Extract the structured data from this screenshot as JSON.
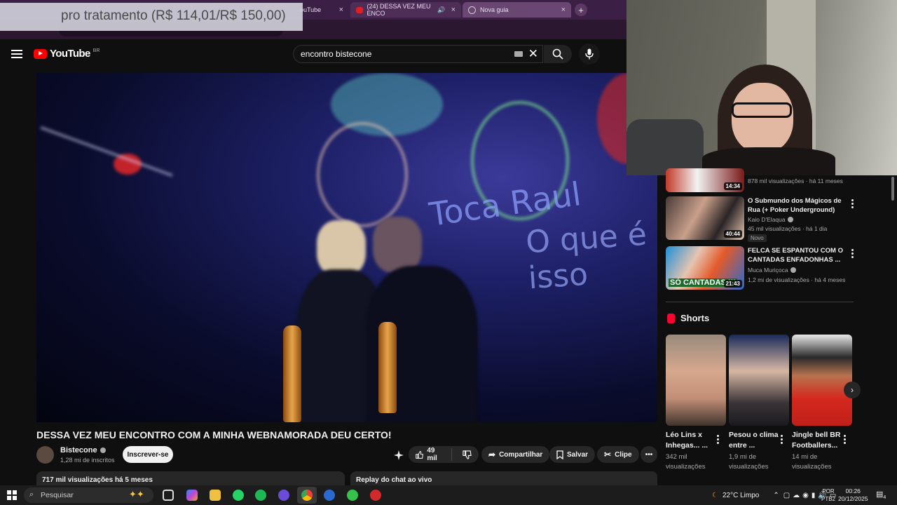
{
  "overlay": {
    "text": "pro tratamento (R$ 114,01/R$ 150,00)"
  },
  "browser": {
    "tabs": [
      {
        "label": "ouTube"
      },
      {
        "label": "(24) DESSA VEZ MEU ENCO"
      },
      {
        "label": "Nova guia"
      }
    ],
    "new_tab": "+",
    "close_glyph": "×"
  },
  "youtube": {
    "logo_text": "YouTube",
    "region": "BR",
    "search_query": "encontro bistecone",
    "video": {
      "title": "DESSA VEZ MEU ENCONTRO COM A MINHA WEBNAMORADA DEU CERTO!",
      "channel": "Bistecone",
      "subscribers": "1,28 mi de inscritos",
      "subscribe_label": "Inscrever-se",
      "likes": "49 mil",
      "share_label": "Compartilhar",
      "save_label": "Salvar",
      "clip_label": "Clipe",
      "views_date": "717 mil visualizações  há 5 meses",
      "chat_replay": "Replay do chat ao vivo",
      "graffiti_1": "Toca Raul",
      "graffiti_2": "O que é isso"
    },
    "recommendations": [
      {
        "duration": "14:34",
        "meta": "878 mil visualizações · há 11 meses"
      },
      {
        "title": "O Submundo dos Mágicos de Rua (+ Poker Underground)",
        "channel": "Kaio D'Elaqua",
        "meta": "45 mil visualizações · há 1 dia",
        "badge": "Novo",
        "duration": "40:44"
      },
      {
        "title": "FELCA SE ESPANTOU COM O CANTADAS ENFADONHAS ...",
        "channel": "Muca Muriçoca",
        "meta": "1,2 mi de visualizações · há 4 meses",
        "duration": "21:43",
        "thumb_text": "SÓ CANTADAS !!!"
      }
    ],
    "shorts": {
      "heading": "Shorts",
      "items": [
        {
          "title": "Léo Lins x Inhegas... ...",
          "views": "342 mil visualizações"
        },
        {
          "title": "Pesou o clima entre ...",
          "views": "1,9 mi de visualizações"
        },
        {
          "title": "Jingle bell BR Footballers...",
          "views": "14 mi de visualizações"
        }
      ]
    }
  },
  "taskbar": {
    "search_placeholder": "Pesquisar",
    "weather": "22°C  Limpo",
    "lang_1": "POR",
    "lang_2": "PTB2",
    "time": "00:26",
    "date": "20/12/2025",
    "notifications": "4"
  },
  "colors": {
    "accent": "#ff0000",
    "bg": "#0f0f0f"
  }
}
